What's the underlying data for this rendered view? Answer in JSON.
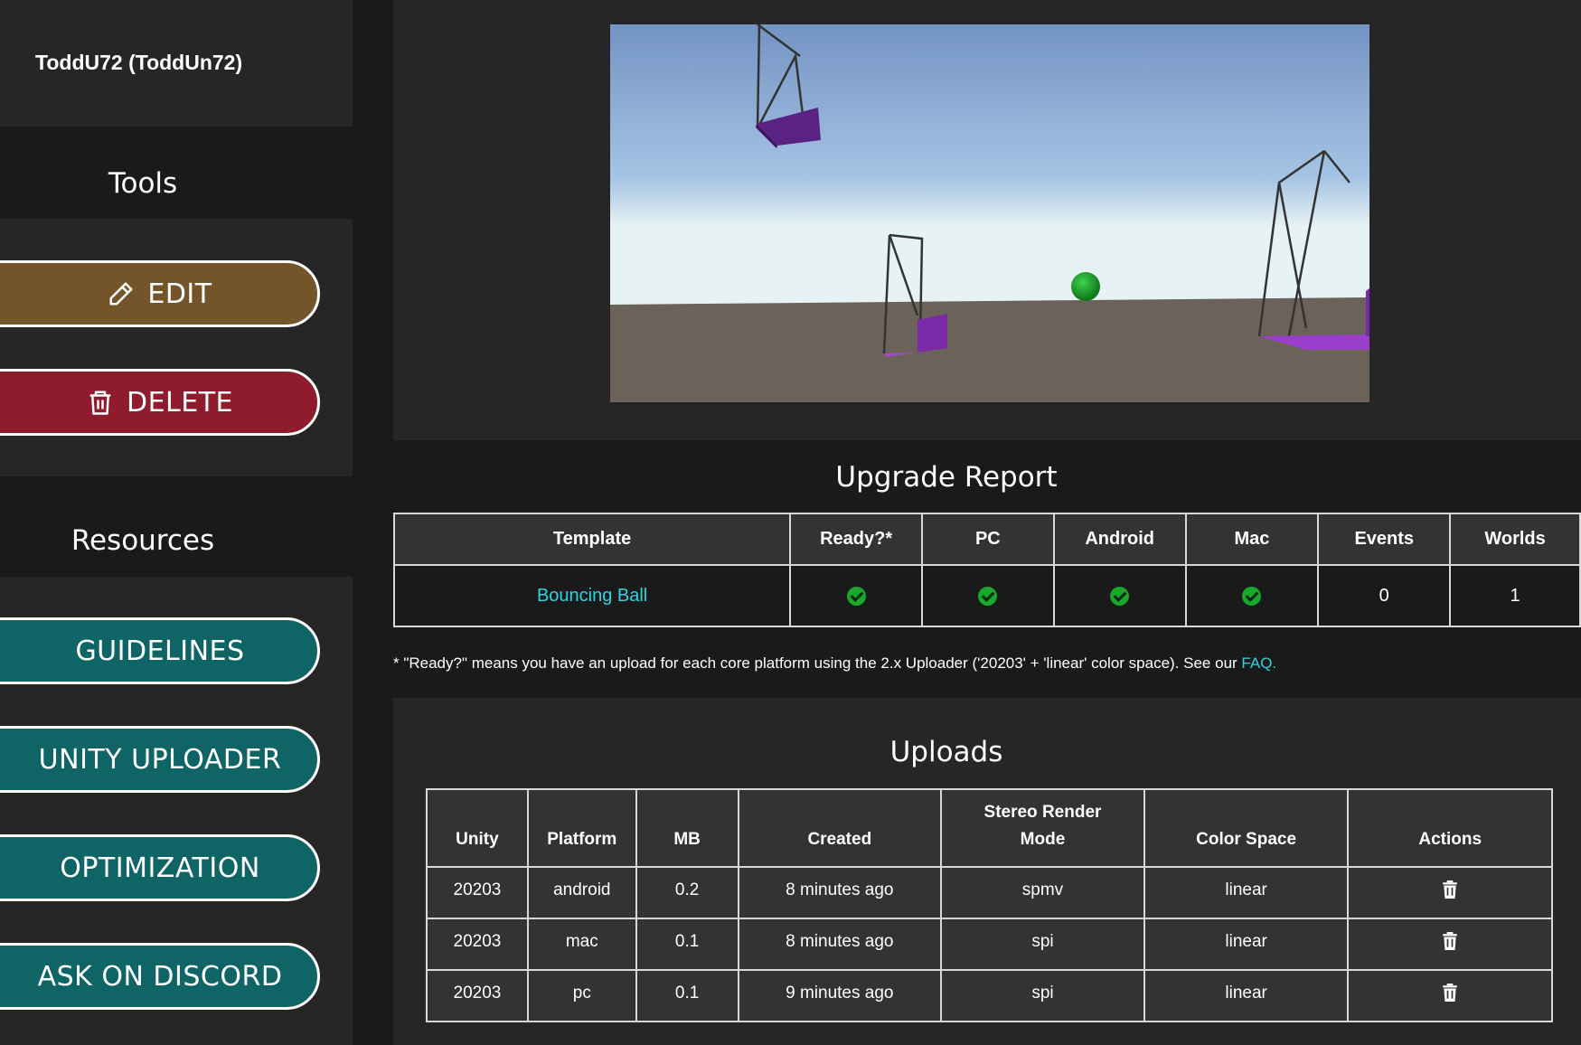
{
  "user": {
    "display": "ToddU72 (ToddUn72)"
  },
  "sidebar": {
    "tools_title": "Tools",
    "edit_label": "EDIT",
    "delete_label": "DELETE",
    "resources_title": "Resources",
    "resources": [
      {
        "label": "GUIDELINES"
      },
      {
        "label": "UNITY UPLOADER"
      },
      {
        "label": "OPTIMIZATION"
      },
      {
        "label": "ASK ON DISCORD"
      }
    ]
  },
  "upgrade_report": {
    "title": "Upgrade Report",
    "headers": [
      "Template",
      "Ready?*",
      "PC",
      "Android",
      "Mac",
      "Events",
      "Worlds"
    ],
    "row": {
      "template": "Bouncing Ball",
      "ready": "check-circle-icon",
      "pc": "check-circle-icon",
      "android": "check-circle-icon",
      "mac": "check-circle-icon",
      "events": "0",
      "worlds": "1"
    },
    "footnote_text": "* \"Ready?\" means you have an upload for each core platform using the 2.x Uploader ('20203' + 'linear' color space). See our ",
    "footnote_link": "FAQ."
  },
  "uploads": {
    "title": "Uploads",
    "headers": [
      "Unity",
      "Platform",
      "MB",
      "Created",
      "Stereo Render Mode",
      "Color Space",
      "Actions"
    ],
    "rows": [
      {
        "unity": "20203",
        "platform": "android",
        "mb": "0.2",
        "created": "8 minutes ago",
        "stereo": "spmv",
        "color": "linear",
        "action": "trash-icon"
      },
      {
        "unity": "20203",
        "platform": "mac",
        "mb": "0.1",
        "created": "8 minutes ago",
        "stereo": "spi",
        "color": "linear",
        "action": "trash-icon"
      },
      {
        "unity": "20203",
        "platform": "pc",
        "mb": "0.1",
        "created": "9 minutes ago",
        "stereo": "spi",
        "color": "linear",
        "action": "trash-icon"
      }
    ]
  },
  "colors": {
    "edit": "#74552a",
    "delete": "#8f1c2c",
    "resource": "#0f6466",
    "link": "#2bd4e0",
    "check": "#17a82c"
  }
}
